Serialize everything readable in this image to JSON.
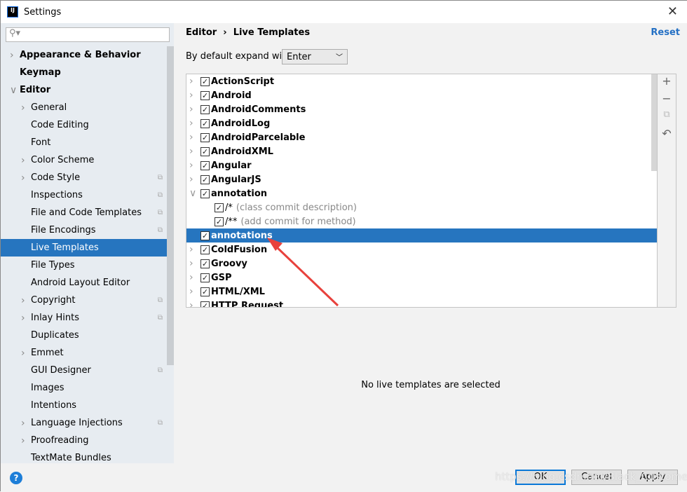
{
  "window": {
    "title": "Settings"
  },
  "sidebar": {
    "search_placeholder": "",
    "items": [
      {
        "label": "Appearance & Behavior",
        "level": 0,
        "bold": true,
        "chevron": "right"
      },
      {
        "label": "Keymap",
        "level": 0,
        "bold": true
      },
      {
        "label": "Editor",
        "level": 0,
        "bold": true,
        "chevron": "down"
      },
      {
        "label": "General",
        "level": 1,
        "chevron": "right"
      },
      {
        "label": "Code Editing",
        "level": 1
      },
      {
        "label": "Font",
        "level": 1
      },
      {
        "label": "Color Scheme",
        "level": 1,
        "chevron": "right"
      },
      {
        "label": "Code Style",
        "level": 1,
        "chevron": "right",
        "copy": true
      },
      {
        "label": "Inspections",
        "level": 1,
        "copy": true
      },
      {
        "label": "File and Code Templates",
        "level": 1,
        "copy": true
      },
      {
        "label": "File Encodings",
        "level": 1,
        "copy": true
      },
      {
        "label": "Live Templates",
        "level": 1,
        "selected": true
      },
      {
        "label": "File Types",
        "level": 1
      },
      {
        "label": "Android Layout Editor",
        "level": 1
      },
      {
        "label": "Copyright",
        "level": 1,
        "chevron": "right",
        "copy": true
      },
      {
        "label": "Inlay Hints",
        "level": 1,
        "chevron": "right",
        "copy": true
      },
      {
        "label": "Duplicates",
        "level": 1
      },
      {
        "label": "Emmet",
        "level": 1,
        "chevron": "right"
      },
      {
        "label": "GUI Designer",
        "level": 1,
        "copy": true
      },
      {
        "label": "Images",
        "level": 1
      },
      {
        "label": "Intentions",
        "level": 1
      },
      {
        "label": "Language Injections",
        "level": 1,
        "chevron": "right",
        "copy": true
      },
      {
        "label": "Proofreading",
        "level": 1,
        "chevron": "right"
      },
      {
        "label": "TextMate Bundles",
        "level": 1
      }
    ]
  },
  "main": {
    "breadcrumb": [
      "Editor",
      "Live Templates"
    ],
    "breadcrumb_sep": "›",
    "reset": "Reset",
    "expand_label": "By default expand with",
    "expand_value": "Enter",
    "tree": [
      {
        "label": "ActionScript",
        "checked": true,
        "chevron": "right"
      },
      {
        "label": "Android",
        "checked": true,
        "chevron": "right"
      },
      {
        "label": "AndroidComments",
        "checked": true,
        "chevron": "right"
      },
      {
        "label": "AndroidLog",
        "checked": true,
        "chevron": "right"
      },
      {
        "label": "AndroidParcelable",
        "checked": true,
        "chevron": "right"
      },
      {
        "label": "AndroidXML",
        "checked": true,
        "chevron": "right"
      },
      {
        "label": "Angular",
        "checked": true,
        "chevron": "right"
      },
      {
        "label": "AngularJS",
        "checked": true,
        "chevron": "right"
      },
      {
        "label": "annotation",
        "checked": true,
        "chevron": "down"
      },
      {
        "label": "/*",
        "desc": "(class commit description)",
        "checked": true,
        "child": true
      },
      {
        "label": "/**",
        "desc": "(add commit for method)",
        "checked": true,
        "child": true
      },
      {
        "label": "annotations",
        "checked": true,
        "selected": true
      },
      {
        "label": "ColdFusion",
        "checked": true,
        "chevron": "right"
      },
      {
        "label": "Groovy",
        "checked": true,
        "chevron": "right"
      },
      {
        "label": "GSP",
        "checked": true,
        "chevron": "right"
      },
      {
        "label": "HTML/XML",
        "checked": true,
        "chevron": "right"
      },
      {
        "label": "HTTP Request",
        "checked": true,
        "chevron": "right"
      }
    ],
    "tools": [
      "+",
      "−",
      "⧉",
      "↶"
    ],
    "message": "No live templates are selected"
  },
  "buttons": {
    "ok": "OK",
    "cancel": "Cancel",
    "apply": "Apply",
    "help": "?"
  },
  "watermark": "https://blog.csdn.net/Black_Customer",
  "colors": {
    "selection": "#2675bf",
    "accent": "#2470c4",
    "arrow": "#e8413c"
  }
}
